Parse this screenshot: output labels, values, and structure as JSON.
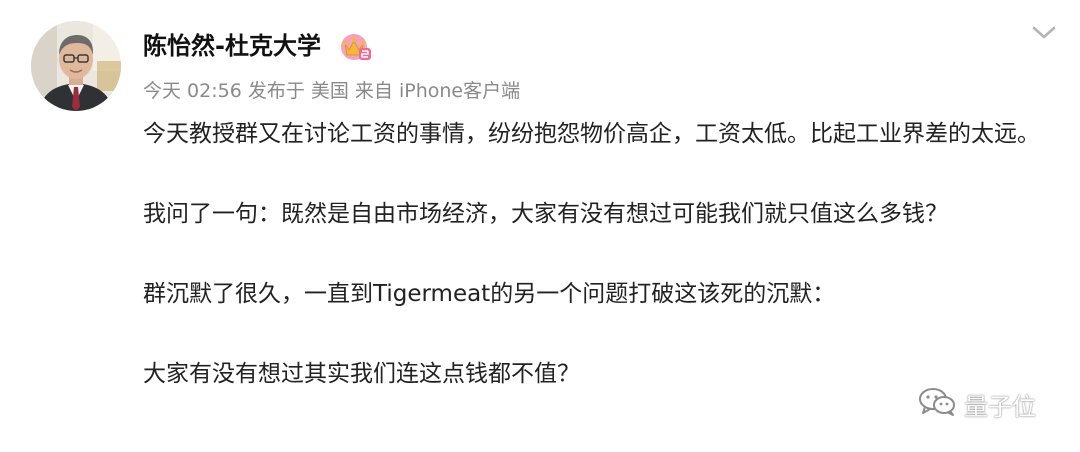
{
  "post": {
    "author_name": "陈怡然-杜克大学",
    "meta_line": "今天 02:56 发布于 美国 来自 iPhone客户端",
    "paragraphs": [
      "今天教授群又在讨论工资的事情，纷纷抱怨物价高企，工资太低。比起工业界差的太远。",
      "我问了一句：既然是自由市场经济，大家有没有想过可能我们就只值这么多钱？",
      "群沉默了很久，一直到Tigermeat的另一个问题打破这该死的沉默：",
      "大家有没有想过其实我们连这点钱都不值？"
    ]
  },
  "icons": {
    "avatar": "author-avatar",
    "badge": "crown-vip-icon",
    "more": "chevron-down-icon",
    "watermark_logo": "wechat-logo-icon"
  },
  "watermark": {
    "text": "量子位"
  },
  "colors": {
    "text": "#222222",
    "meta": "#8a8a8a",
    "chevron": "#b5b5b5",
    "badge_pink": "#f06b94",
    "badge_gold": "#f5b73b"
  }
}
